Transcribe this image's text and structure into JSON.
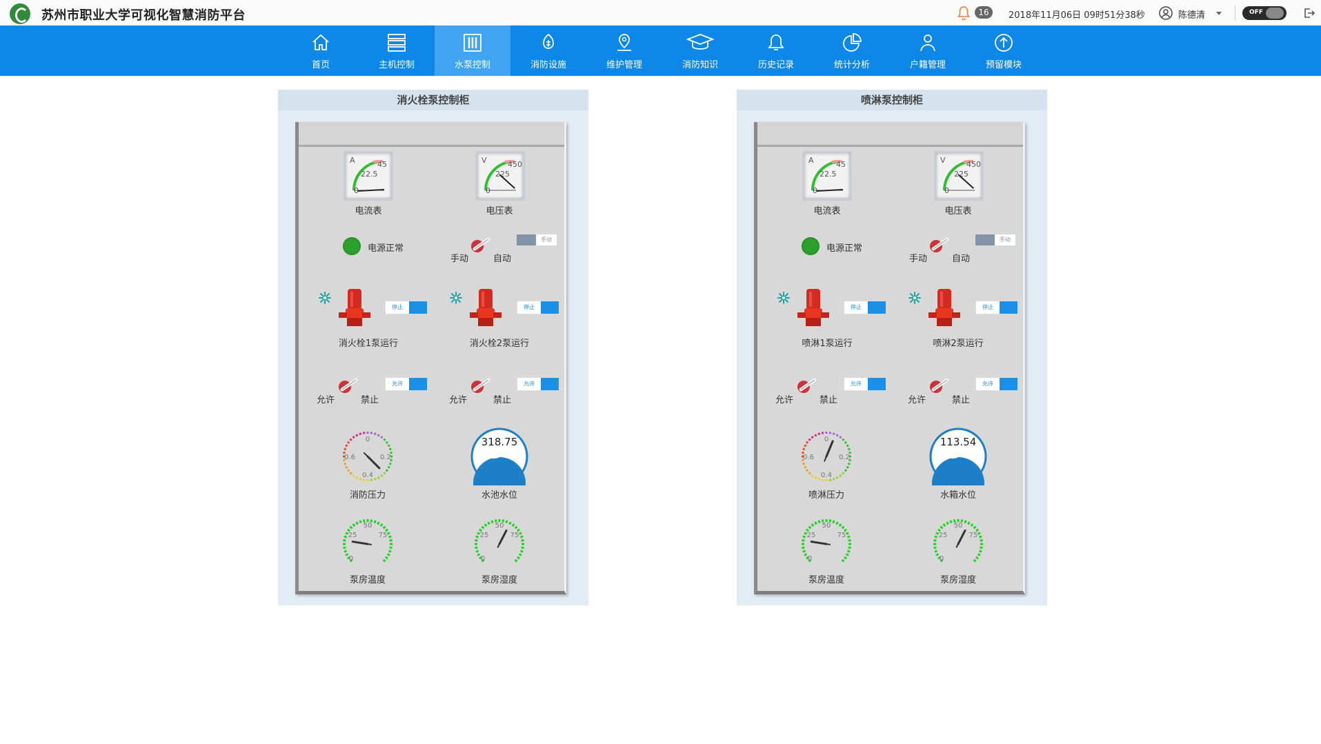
{
  "header": {
    "title": "苏州市职业大学可视化智慧消防平台",
    "notification_count": "16",
    "datetime": "2018年11月06日 09时51分38秒",
    "username": "陈德清",
    "toggle_label": "OFF"
  },
  "nav": {
    "items": [
      {
        "label": "首页",
        "icon": "home-icon"
      },
      {
        "label": "主机控制",
        "icon": "server-icon"
      },
      {
        "label": "水泵控制",
        "icon": "pump-control-icon",
        "active": true
      },
      {
        "label": "消防设施",
        "icon": "fire-facility-icon"
      },
      {
        "label": "维护管理",
        "icon": "map-pin-icon"
      },
      {
        "label": "消防知识",
        "icon": "graduation-cap-icon"
      },
      {
        "label": "历史记录",
        "icon": "bell-icon"
      },
      {
        "label": "统计分析",
        "icon": "pie-chart-icon"
      },
      {
        "label": "户籍管理",
        "icon": "user-icon"
      },
      {
        "label": "预留模块",
        "icon": "upload-circle-icon"
      }
    ]
  },
  "panels": [
    {
      "title": "消火栓泵控制柜",
      "ammeter": {
        "label": "电流表",
        "unit": "A",
        "max": "45",
        "mid": "22.5",
        "min": "0"
      },
      "voltmeter": {
        "label": "电压表",
        "unit": "V",
        "max": "450",
        "mid": "225",
        "min": "0"
      },
      "power": {
        "label": "电源正常",
        "status_color": "#2da12d"
      },
      "mode": {
        "manual": "手动",
        "auto": "自动",
        "switch_label": "手动"
      },
      "pump1": {
        "label": "消火栓1泵运行",
        "switch_label": "停止"
      },
      "pump2": {
        "label": "消火栓2泵运行",
        "switch_label": "停止"
      },
      "perm1": {
        "allow": "允许",
        "deny": "禁止",
        "switch_label": "允许"
      },
      "perm2": {
        "allow": "允许",
        "deny": "禁止",
        "switch_label": "允许"
      },
      "pressure": {
        "label": "消防压力",
        "ticks": [
          "0",
          "0.2",
          "0.4",
          "0.6"
        ],
        "value": 0.3
      },
      "level": {
        "label": "水池水位",
        "value": "318.75"
      },
      "temp": {
        "label": "泵房温度",
        "ticks": [
          "0",
          "25",
          "50",
          "75"
        ],
        "value": 20
      },
      "humidity": {
        "label": "泵房湿度",
        "ticks": [
          "0",
          "25",
          "50",
          "75"
        ],
        "value": 60
      }
    },
    {
      "title": "喷淋泵控制柜",
      "ammeter": {
        "label": "电流表",
        "unit": "A",
        "max": "45",
        "mid": "22.5",
        "min": "0"
      },
      "voltmeter": {
        "label": "电压表",
        "unit": "V",
        "max": "450",
        "mid": "225",
        "min": "0"
      },
      "power": {
        "label": "电源正常",
        "status_color": "#2da12d"
      },
      "mode": {
        "manual": "手动",
        "auto": "自动",
        "switch_label": "手动"
      },
      "pump1": {
        "label": "喷淋1泵运行",
        "switch_label": "停止"
      },
      "pump2": {
        "label": "喷淋2泵运行",
        "switch_label": "停止"
      },
      "perm1": {
        "allow": "允许",
        "deny": "禁止",
        "switch_label": "允许"
      },
      "perm2": {
        "allow": "允许",
        "deny": "禁止",
        "switch_label": "允许"
      },
      "pressure": {
        "label": "喷淋压力",
        "ticks": [
          "0",
          "0.2",
          "0.4",
          "0.6"
        ],
        "value": 0.05
      },
      "level": {
        "label": "水箱水位",
        "value": "113.54"
      },
      "temp": {
        "label": "泵房温度",
        "ticks": [
          "0",
          "25",
          "50",
          "75"
        ],
        "value": 20
      },
      "humidity": {
        "label": "泵房湿度",
        "ticks": [
          "0",
          "25",
          "50",
          "75"
        ],
        "value": 60
      }
    }
  ]
}
